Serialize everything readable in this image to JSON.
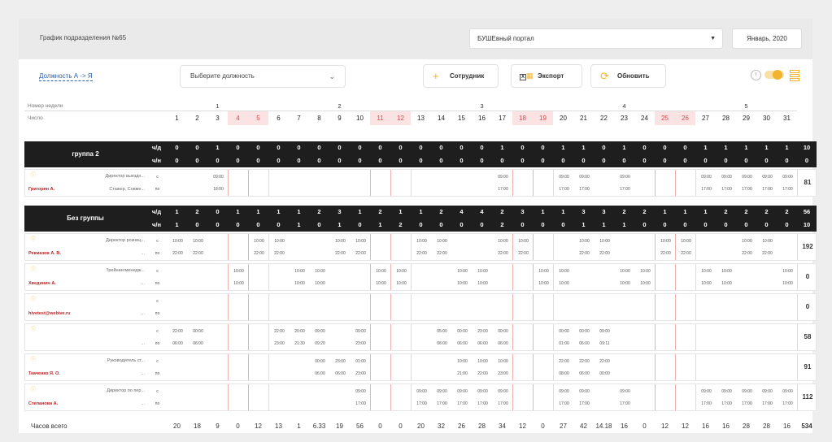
{
  "header": {
    "title": "График подразделения №65",
    "portal": "БУШЕвный портал",
    "month": "Январь, 2020"
  },
  "toolbar": {
    "sort_label": "Должность А -> Я",
    "position_placeholder": "Выберите должность",
    "employee_label": "Сотрудник",
    "export_label": "Экспорт",
    "refresh_label": "Обновить"
  },
  "grid": {
    "week_label": "Номер недели",
    "date_label": "Число",
    "weeks": [
      {
        "label": "1",
        "from": 1,
        "to": 5
      },
      {
        "label": "2",
        "from": 6,
        "to": 12
      },
      {
        "label": "3",
        "from": 13,
        "to": 19
      },
      {
        "label": "4",
        "from": 20,
        "to": 26
      },
      {
        "label": "5",
        "from": 27,
        "to": 31
      }
    ],
    "days": [
      1,
      2,
      3,
      4,
      5,
      6,
      7,
      8,
      9,
      10,
      11,
      12,
      13,
      14,
      15,
      16,
      17,
      18,
      19,
      20,
      21,
      22,
      23,
      24,
      25,
      26,
      27,
      28,
      29,
      30,
      31
    ],
    "weekends": [
      4,
      5,
      11,
      12,
      18,
      19,
      25,
      26
    ],
    "groups": [
      {
        "name": "группа 2",
        "cd_label": "ч/д",
        "ch_label": "ч/н",
        "cd": [
          "0",
          "0",
          "1",
          "0",
          "0",
          "0",
          "0",
          "0",
          "0",
          "0",
          "0",
          "0",
          "0",
          "0",
          "0",
          "0",
          "1",
          "0",
          "0",
          "1",
          "1",
          "0",
          "1",
          "0",
          "0",
          "0",
          "1",
          "1",
          "1",
          "1",
          "1"
        ],
        "cd_total": "10",
        "ch": [
          "0",
          "0",
          "0",
          "0",
          "0",
          "0",
          "0",
          "0",
          "0",
          "0",
          "0",
          "0",
          "0",
          "0",
          "0",
          "0",
          "0",
          "0",
          "0",
          "0",
          "0",
          "0",
          "0",
          "0",
          "0",
          "0",
          "0",
          "0",
          "0",
          "0",
          "0"
        ],
        "ch_total": "0",
        "employees": [
          {
            "pos": "Директор выездн...",
            "name": "Григорян А.",
            "sub": "Стажер, Совме...",
            "total": "81",
            "s": {
              "3": "09:00",
              "17": "09:00",
              "20": "09:00",
              "21": "09:00",
              "23": "09:00",
              "27": "09:00",
              "28": "09:00",
              "29": "09:00",
              "30": "09:00",
              "31": "09:00"
            },
            "e": {
              "3": "18:00",
              "17": "17:00",
              "20": "17:00",
              "21": "17:00",
              "23": "17:00",
              "27": "17:00",
              "28": "17:00",
              "29": "17:00",
              "30": "17:00",
              "31": "17:00"
            }
          }
        ]
      },
      {
        "name": "Без группы",
        "cd_label": "ч/д",
        "ch_label": "ч/н",
        "cd": [
          "1",
          "2",
          "0",
          "1",
          "1",
          "1",
          "1",
          "2",
          "3",
          "1",
          "2",
          "1",
          "1",
          "2",
          "4",
          "4",
          "2",
          "3",
          "1",
          "1",
          "3",
          "3",
          "2",
          "2",
          "1",
          "1",
          "1",
          "2",
          "2",
          "2",
          "2"
        ],
        "cd_total": "56",
        "ch": [
          "1",
          "0",
          "0",
          "0",
          "0",
          "0",
          "1",
          "0",
          "1",
          "0",
          "1",
          "2",
          "0",
          "0",
          "0",
          "0",
          "2",
          "0",
          "0",
          "0",
          "1",
          "1",
          "1",
          "0",
          "0",
          "0",
          "0",
          "0",
          "0",
          "0",
          "0"
        ],
        "ch_total": "10",
        "employees": [
          {
            "pos": "Директор розниц...",
            "name": "Рекмазов А. В.",
            "sub": "...",
            "total": "192",
            "s": {
              "1": "10:00",
              "2": "10:00",
              "5": "10:00",
              "6": "10:00",
              "9": "10:00",
              "10": "10:00",
              "13": "10:00",
              "14": "10:00",
              "17": "10:00",
              "18": "10:00",
              "21": "10:00",
              "22": "10:00",
              "25": "10:00",
              "26": "10:00",
              "29": "10:00",
              "30": "10:00"
            },
            "e": {
              "1": "22:00",
              "2": "22:00",
              "5": "22:00",
              "6": "22:00",
              "9": "22:00",
              "10": "22:00",
              "13": "22:00",
              "14": "22:00",
              "17": "22:00",
              "18": "22:00",
              "21": "22:00",
              "22": "22:00",
              "25": "22:00",
              "26": "22:00",
              "29": "22:00",
              "30": "22:00"
            }
          },
          {
            "pos": "Трейнингменедж...",
            "name": "Хвединич А.",
            "sub": "...",
            "total": "0",
            "s": {
              "4": "10:00",
              "7": "10:00",
              "8": "10:00",
              "11": "10:00",
              "12": "10:00",
              "15": "10:00",
              "16": "10:00",
              "19": "10:00",
              "20": "10:00",
              "23": "10:00",
              "24": "10:00",
              "27": "10:00",
              "28": "10:00",
              "31": "10:00"
            },
            "e": {
              "4": "10:00",
              "7": "10:00",
              "8": "10:00",
              "11": "10:00",
              "12": "10:00",
              "15": "10:00",
              "16": "10:00",
              "19": "10:00",
              "20": "10:00",
              "23": "10:00",
              "24": "10:00",
              "27": "10:00",
              "28": "10:00",
              "31": "10:00"
            }
          },
          {
            "pos": "",
            "name": "hivetest@webive.ru",
            "sub": "...",
            "total": "0",
            "s": {},
            "e": {}
          },
          {
            "pos": "",
            "name": "",
            "sub": "...",
            "total": "58",
            "s": {
              "1": "22:00",
              "2": "00:00",
              "6": "22:00",
              "7": "20:00",
              "8": "09:00",
              "10": "09:00",
              "14": "05:00",
              "15": "00:00",
              "16": "23:00",
              "17": "00:00",
              "20": "00:00",
              "21": "00:00",
              "22": "09:00"
            },
            "e": {
              "1": "06:00",
              "2": "06:00",
              "6": "23:00",
              "7": "21:30",
              "8": "09:20",
              "10": "23:00",
              "14": "06:00",
              "15": "06:00",
              "16": "06:00",
              "17": "06:00",
              "20": "01:00",
              "21": "06:00",
              "22": "09:11"
            }
          },
          {
            "pos": "Руководитель ст...",
            "name": "Ткаченко Я. О.",
            "sub": "...",
            "total": "91",
            "s": {
              "8": "00:00",
              "9": "23:00",
              "10": "01:00",
              "15": "10:00",
              "16": "10:00",
              "17": "10:00",
              "20": "22:00",
              "21": "22:00",
              "22": "22:00"
            },
            "e": {
              "8": "06:00",
              "9": "06:00",
              "10": "23:00",
              "15": "21:00",
              "16": "22:00",
              "17": "23:00",
              "20": "08:00",
              "21": "06:00",
              "22": "00:00"
            }
          },
          {
            "pos": "Директор по пер...",
            "name": "Степанова А.",
            "sub": "...",
            "total": "112",
            "s": {
              "10": "09:00",
              "13": "09:00",
              "14": "09:00",
              "15": "09:00",
              "16": "09:00",
              "17": "09:00",
              "20": "09:00",
              "21": "09:00",
              "23": "09:00",
              "27": "09:00",
              "28": "09:00",
              "29": "09:00",
              "30": "09:00",
              "31": "09:00"
            },
            "e": {
              "10": "17:00",
              "13": "17:00",
              "14": "17:00",
              "15": "17:00",
              "16": "17:00",
              "17": "17:00",
              "20": "17:00",
              "21": "17:00",
              "23": "17:00",
              "27": "17:00",
              "28": "17:00",
              "29": "17:00",
              "30": "17:00",
              "31": "17:00"
            }
          }
        ]
      }
    ],
    "start_label": "с",
    "end_label": "по",
    "summary": {
      "label": "Часов всего",
      "values": [
        "20",
        "18",
        "9",
        "0",
        "12",
        "13",
        "1",
        "6.33",
        "19",
        "56",
        "0",
        "0",
        "20",
        "32",
        "26",
        "28",
        "34",
        "12",
        "0",
        "27",
        "42",
        "14.18",
        "16",
        "0",
        "12",
        "12",
        "16",
        "16",
        "28",
        "28",
        "16"
      ],
      "total": "534"
    }
  }
}
